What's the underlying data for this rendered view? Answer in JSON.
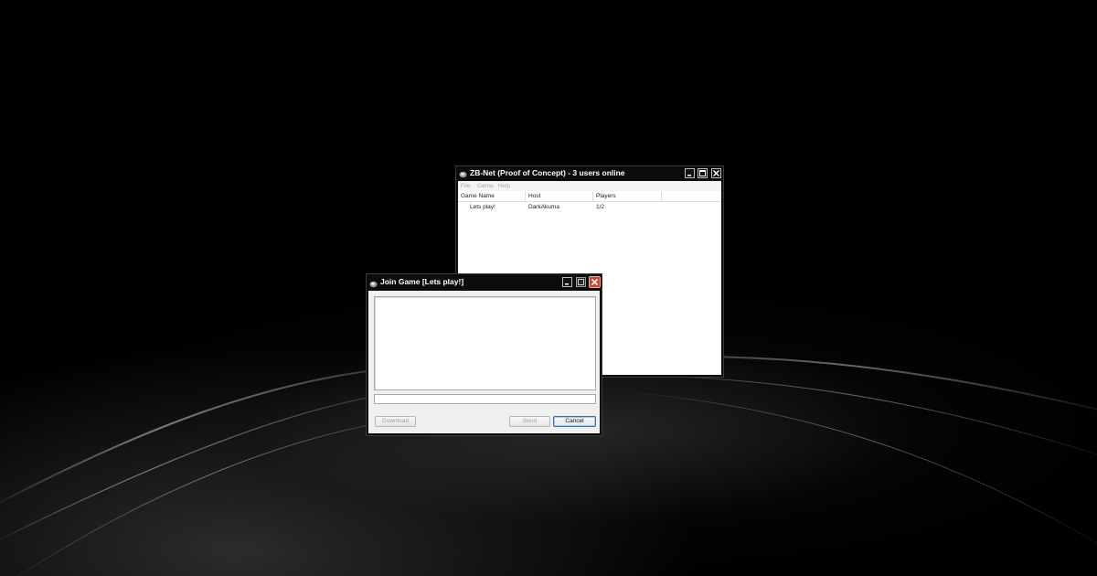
{
  "main_window": {
    "title": "ZB-Net (Proof of Concept) - 3 users online",
    "menu": [
      "File",
      "Game",
      "Help"
    ],
    "columns": [
      "Game Name",
      "Host",
      "Players"
    ],
    "rows": [
      {
        "game_name": "Lets play!",
        "host": "DarkAkuma",
        "players": "1/2"
      }
    ]
  },
  "join_dialog": {
    "title": "Join Game [Lets play!]",
    "chat_log": "",
    "message_value": "",
    "download_label": "Download",
    "send_label": "Send",
    "cancel_label": "Cancel"
  },
  "colors": {
    "desktop": "#000000",
    "titlebar": "#0c0c0c",
    "close_red": "#c8452f",
    "default_button_border": "#3a6ea5"
  },
  "icons": {
    "app": "zb-net-app-icon",
    "minimize": "minimize-icon",
    "maximize": "maximize-icon",
    "close": "close-icon"
  }
}
